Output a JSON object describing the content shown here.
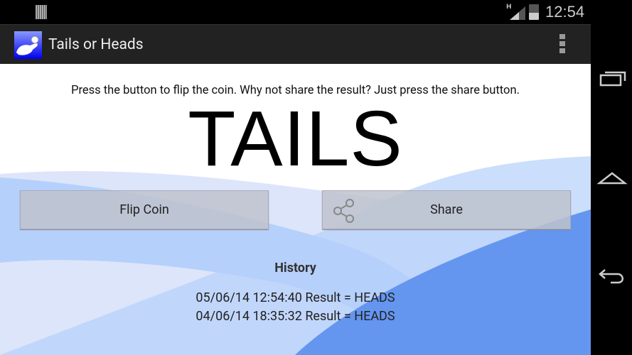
{
  "status_bar": {
    "network_type": "H",
    "time": "12:54",
    "icons": [
      "notification-icon",
      "signal-icon",
      "battery-charging-icon"
    ]
  },
  "action_bar": {
    "title": "Tails or Heads",
    "icon": "app-coin-hand-icon",
    "overflow_icon": "overflow-menu-icon"
  },
  "main": {
    "instructions": "Press the button to flip the coin. Why not share the result? Just press the share button.",
    "result": "TAILS",
    "flip_label": "Flip Coin",
    "share_label": "Share",
    "history_title": "History",
    "history": [
      "05/06/14 12:54:40 Result = HEADS",
      "04/06/14 18:35:32 Result = HEADS"
    ]
  },
  "nav_bar": {
    "icons": [
      "recent-apps-icon",
      "home-icon",
      "back-icon"
    ]
  },
  "colors": {
    "wave_light": "#dde5fb",
    "wave_mid": "#b5d0fb",
    "wave_dark": "#6496f0"
  }
}
